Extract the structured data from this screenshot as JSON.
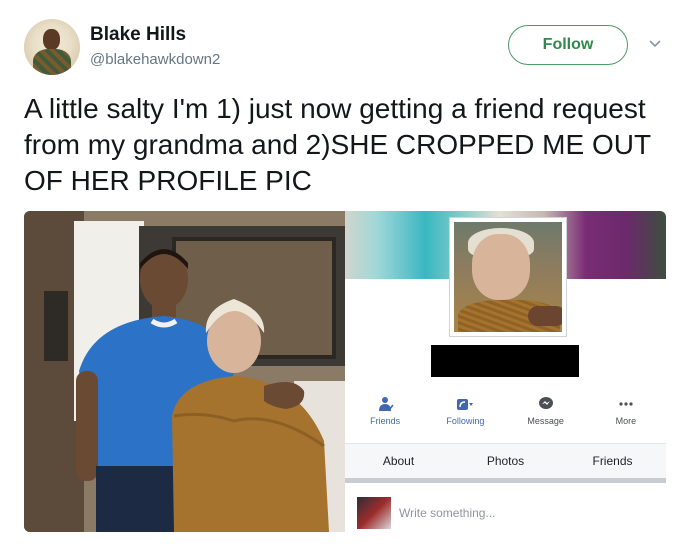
{
  "tweet": {
    "author_name": "Blake Hills",
    "handle": "@blakehawkdown2",
    "follow_label": "Follow",
    "text": "A little salty I'm 1) just now getting a friend request from my grandma and 2)SHE CROPPED ME OUT OF HER PROFILE PIC"
  },
  "facebook_panel": {
    "actions": [
      {
        "label": "Friends",
        "icon": "add-friend-icon"
      },
      {
        "label": "Following",
        "icon": "rss-follow-icon"
      },
      {
        "label": "Message",
        "icon": "messenger-icon"
      },
      {
        "label": "More",
        "icon": "more-dots-icon"
      }
    ],
    "tabs": [
      {
        "label": "About"
      },
      {
        "label": "Photos"
      },
      {
        "label": "Friends"
      }
    ],
    "composer_placeholder": "Write something..."
  },
  "colors": {
    "follow_border": "#4b9a62",
    "follow_text": "#2f8a4c",
    "facebook_blue": "#4267b2",
    "handle_gray": "#657786"
  }
}
